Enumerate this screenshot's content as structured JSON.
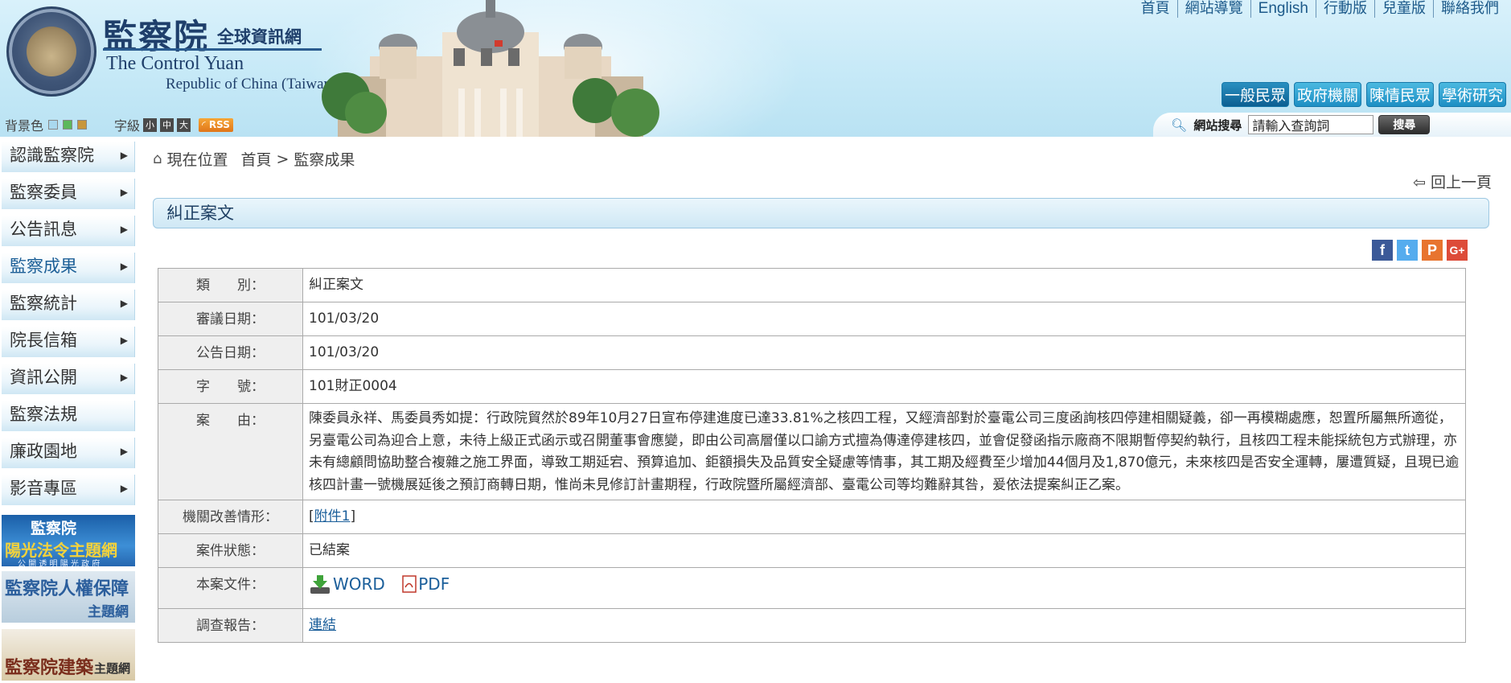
{
  "header": {
    "logo_zh": "監察院",
    "logo_zh_sub": "全球資訊網",
    "logo_en1": "The Control Yuan",
    "logo_en2": "Republic of China (Taiwan)",
    "top_links": [
      "首頁",
      "網站導覽",
      "English",
      "行動版",
      "兒童版",
      "聯絡我們"
    ],
    "audience_tabs": [
      "一般民眾",
      "政府機關",
      "陳情民眾",
      "學術研究"
    ],
    "bg_label": "背景色",
    "font_label": "字級",
    "font_sizes": [
      "小",
      "中",
      "大"
    ],
    "rss": "RSS",
    "search_label": "網站搜尋",
    "search_placeholder": "請輸入查詢詞",
    "search_button": "搜尋",
    "swatch_colors": [
      "#a9d8ee",
      "#5cb85c",
      "#c8963c"
    ]
  },
  "sidebar": {
    "items": [
      "認識監察院",
      "監察委員",
      "公告訊息",
      "監察成果",
      "監察統計",
      "院長信箱",
      "資訊公開",
      "監察法規",
      "廉政園地",
      "影音專區"
    ],
    "active_index": 3,
    "banner1": {
      "line1": "監察院",
      "line2": "陽光法令主題網",
      "line3": "公 開 透 明   陽 光 政 府"
    },
    "banner2": {
      "title": "監察院人權保障",
      "sub": "主題網"
    },
    "banner3": {
      "title": "監察院建築",
      "sub": "主題網"
    }
  },
  "main": {
    "location_label": "現在位置",
    "breadcrumb": [
      "首頁",
      "監察成果"
    ],
    "breadcrumb_sep": ">",
    "back_label": "回上一頁",
    "section_title": "糾正案文",
    "share": [
      "f",
      "t",
      "P",
      "G+"
    ],
    "rows": [
      {
        "label": "類　　別：",
        "value": "糾正案文"
      },
      {
        "label": "審議日期：",
        "value": "101/03/20"
      },
      {
        "label": "公告日期：",
        "value": "101/03/20"
      },
      {
        "label": "字　　號：",
        "value": "101財正0004"
      },
      {
        "label": "案　　由：",
        "value": "陳委員永祥、馬委員秀如提：行政院貿然於89年10月27日宣布停建進度已達33.81%之核四工程，又經濟部對於臺電公司三度函詢核四停建相關疑義，卻一再模糊處應，恕置所屬無所適從，另臺電公司為迎合上意，未待上級正式函示或召開董事會應變，即由公司高層僅以口諭方式擅為傳達停建核四，並會促發函指示廠商不限期暫停契約執行，且核四工程未能採統包方式辦理，亦未有總顧問協助整合複雜之施工界面，導致工期延宕、預算追加、鉅額損失及品質安全疑慮等情事，其工期及經費至少增加44個月及1,870億元，未來核四是否安全運轉，屢遭質疑，且現已逾核四計畫一號機展延後之預訂商轉日期，惟尚未見修訂計畫期程，行政院暨所屬經濟部、臺電公司等均難辭其咎，爰依法提案糾正乙案。"
      },
      {
        "label": "機關改善情形：",
        "value_prefix": "[",
        "link": "附件1",
        "value_suffix": "]"
      },
      {
        "label": "案件狀態：",
        "value": "已結案"
      },
      {
        "label": "本案文件：",
        "downloads": [
          "WORD",
          "PDF"
        ]
      },
      {
        "label": "調查報告：",
        "link": "連結"
      }
    ]
  }
}
